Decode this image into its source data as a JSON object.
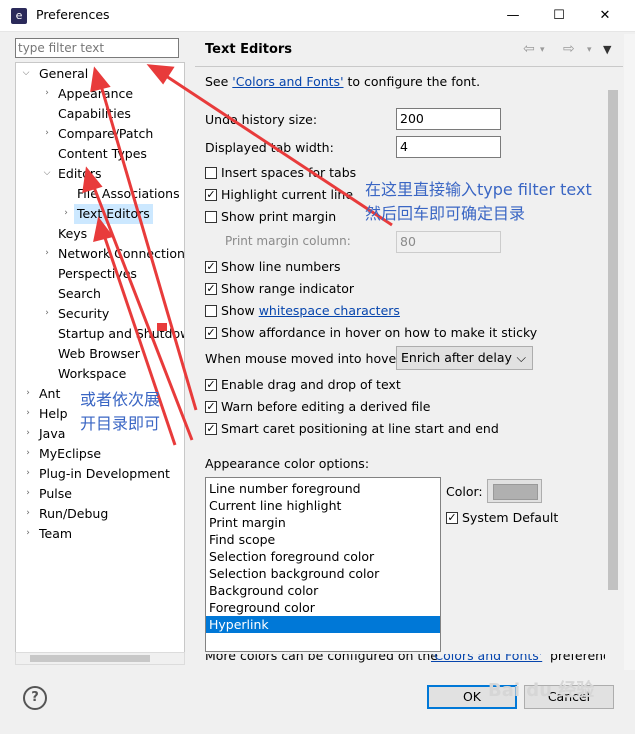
{
  "window": {
    "title": "Preferences",
    "minimize": "—",
    "maximize": "☐",
    "close": "✕"
  },
  "filter": {
    "placeholder": "type filter text"
  },
  "tree": {
    "general": "General",
    "appearance": "Appearance",
    "capabilities": "Capabilities",
    "compare": "Compare/Patch",
    "content_types": "Content Types",
    "editors": "Editors",
    "file_assoc": "File Associations",
    "text_editors": "Text Editors",
    "keys": "Keys",
    "network": "Network Connections",
    "perspectives": "Perspectives",
    "search": "Search",
    "security": "Security",
    "startup": "Startup and Shutdown",
    "web_browser": "Web Browser",
    "workspace": "Workspace",
    "ant": "Ant",
    "help": "Help",
    "java": "Java",
    "myeclipse": "MyEclipse",
    "plugin": "Plug-in Development",
    "pulse": "Pulse",
    "run_debug": "Run/Debug",
    "team": "Team"
  },
  "page": {
    "title": "Text Editors",
    "see_prefix": "See ",
    "see_link": "'Colors and Fonts'",
    "see_suffix": " to configure the font.",
    "undo_label": "Undo history size:",
    "undo_value": "200",
    "tab_label": "Displayed tab width:",
    "tab_value": "4",
    "cb_insert_spaces": "Insert spaces for tabs",
    "cb_highlight_line": "Highlight current line",
    "cb_print_margin": "Show print margin",
    "margin_col_label": "Print margin column:",
    "margin_col_value": "80",
    "cb_line_numbers": "Show line numbers",
    "cb_range": "Show range indicator",
    "cb_whitespace_prefix": "Show ",
    "cb_whitespace_link": "whitespace characters",
    "cb_affordance": "Show affordance in hover on how to make it sticky",
    "hover_label": "When mouse moved into hover:",
    "hover_value": "Enrich after delay",
    "cb_drag_drop": "Enable drag and drop of text",
    "cb_warn": "Warn before editing a derived file",
    "cb_smart_caret": "Smart caret positioning at line start and end",
    "appearance_label": "Appearance color options:",
    "color_items": [
      "Line number foreground",
      "Current line highlight",
      "Print margin",
      "Find scope",
      "Selection foreground color",
      "Selection background color",
      "Background color",
      "Foreground color",
      "Hyperlink"
    ],
    "color_label": "Color:",
    "system_default": "System Default",
    "cutoff_left": "More colors can be configured on the",
    "cutoff_link": "'Colors and Fonts'",
    "cutoff_right": "preference p"
  },
  "buttons": {
    "ok": "OK",
    "cancel": "Cancel",
    "help": "?"
  },
  "annotations": {
    "a1_line1": "在这里直接输入type filter text",
    "a1_line2": "然后回车即可确定目录",
    "a2_line1": "或者依次展",
    "a2_line2": "开目录即可"
  },
  "watermark": "Bai du 经验",
  "colors": {
    "accent": "#0078d7",
    "annotation": "#3a66c4",
    "arrow": "#e83b3b",
    "selection": "#cce8ff"
  }
}
